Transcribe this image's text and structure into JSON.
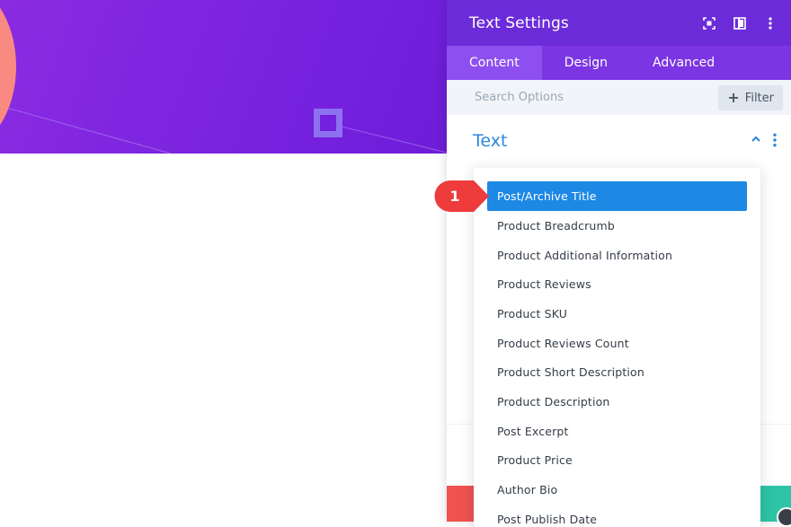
{
  "panel": {
    "title": "Text Settings",
    "header_icons": [
      "expand-icon",
      "sidebar-layout-icon",
      "more-vertical-icon"
    ],
    "tabs": [
      {
        "label": "Content",
        "active": true
      },
      {
        "label": "Design",
        "active": false
      },
      {
        "label": "Advanced",
        "active": false
      }
    ],
    "search": {
      "placeholder": "Search Options",
      "value": ""
    },
    "filter_label": "Filter",
    "section_title": "Text"
  },
  "dropdown": {
    "items": [
      {
        "label": "Post/Archive Title",
        "selected": true
      },
      {
        "label": "Product Breadcrumb",
        "selected": false
      },
      {
        "label": "Product Additional Information",
        "selected": false
      },
      {
        "label": "Product Reviews",
        "selected": false
      },
      {
        "label": "Product SKU",
        "selected": false
      },
      {
        "label": "Product Reviews Count",
        "selected": false
      },
      {
        "label": "Product Short Description",
        "selected": false
      },
      {
        "label": "Product Description",
        "selected": false
      },
      {
        "label": "Post Excerpt",
        "selected": false
      },
      {
        "label": "Product Price",
        "selected": false
      },
      {
        "label": "Author Bio",
        "selected": false
      },
      {
        "label": "Post Publish Date",
        "selected": false
      }
    ]
  },
  "step_marker": {
    "number": "1"
  },
  "colors": {
    "header_purple": "#6c2bd9",
    "tabs_purple": "#7b35e3",
    "active_tab": "#8e4ff0",
    "accent_blue": "#2b87da",
    "selected_item": "#1e88e5",
    "marker_red": "#ee3b3b"
  }
}
